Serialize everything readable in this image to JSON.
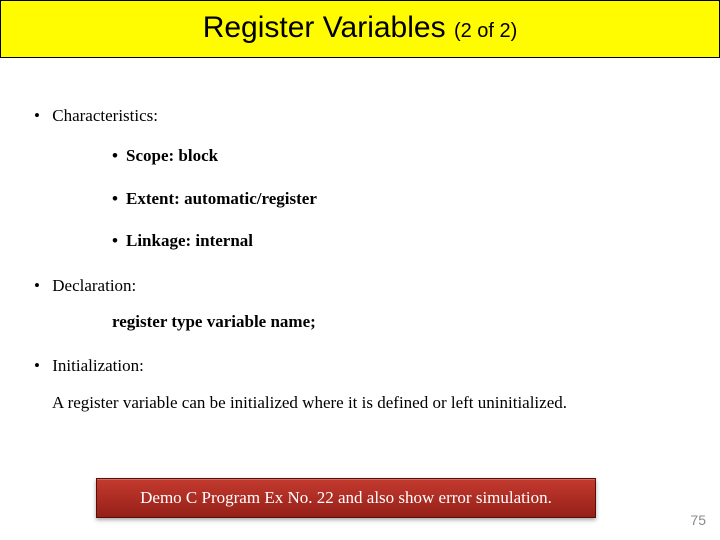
{
  "title": {
    "main": "Register Variables ",
    "sub": "(2 of 2)"
  },
  "sections": {
    "characteristics": {
      "heading": "Characteristics:",
      "items": [
        "Scope: block",
        "Extent: automatic/register",
        "Linkage: internal"
      ]
    },
    "declaration": {
      "heading": "Declaration:",
      "body": "register type variable name;"
    },
    "initialization": {
      "heading": "Initialization:",
      "body": "A register variable can be initialized where it is defined or left uninitialized."
    }
  },
  "demo": "Demo C Program Ex No. 22 and also show error simulation.",
  "page": "75"
}
